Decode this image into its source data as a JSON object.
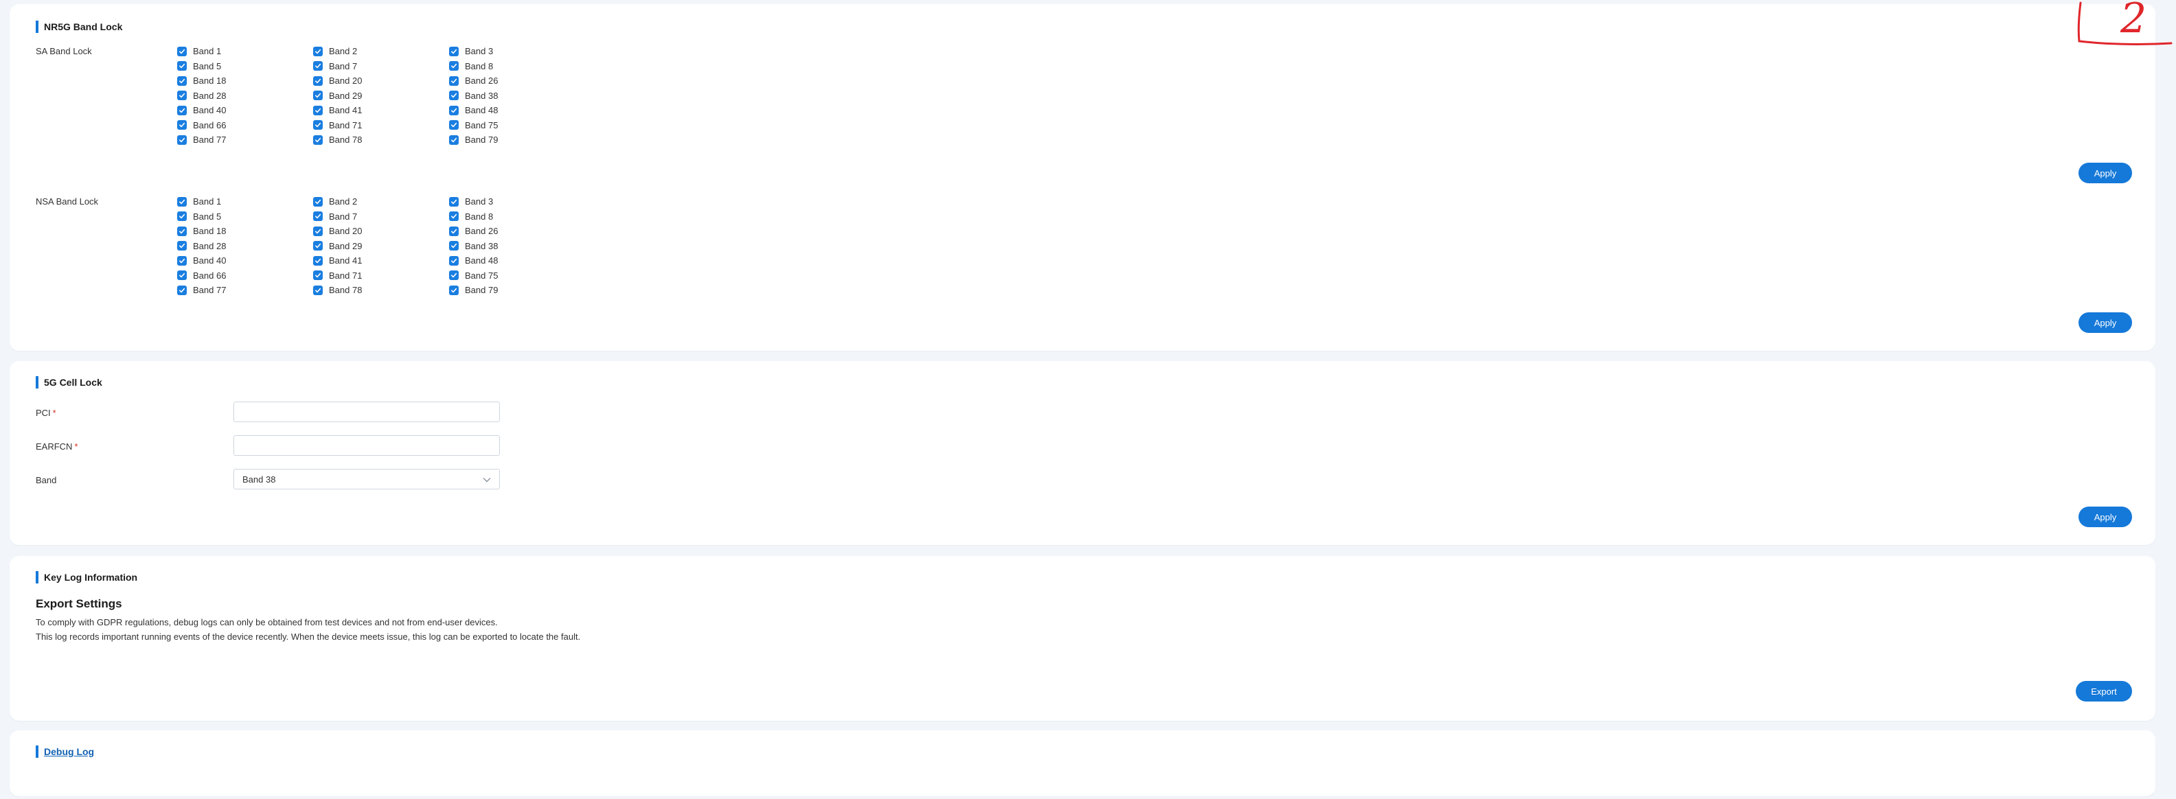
{
  "band_lock": {
    "title": "NR5G Band Lock",
    "sa": {
      "label": "SA Band Lock",
      "bands": [
        "Band 1",
        "Band 2",
        "Band 3",
        "Band 5",
        "Band 7",
        "Band 8",
        "Band 18",
        "Band 20",
        "Band 26",
        "Band 28",
        "Band 29",
        "Band 38",
        "Band 40",
        "Band 41",
        "Band 48",
        "Band 66",
        "Band 71",
        "Band 75",
        "Band 77",
        "Band 78",
        "Band 79"
      ],
      "apply_label": "Apply"
    },
    "nsa": {
      "label": "NSA Band Lock",
      "bands": [
        "Band 1",
        "Band 2",
        "Band 3",
        "Band 5",
        "Band 7",
        "Band 8",
        "Band 18",
        "Band 20",
        "Band 26",
        "Band 28",
        "Band 29",
        "Band 38",
        "Band 40",
        "Band 41",
        "Band 48",
        "Band 66",
        "Band 71",
        "Band 75",
        "Band 77",
        "Band 78",
        "Band 79"
      ],
      "apply_label": "Apply"
    },
    "checked": true
  },
  "cell_lock": {
    "title": "5G Cell Lock",
    "pci_label": "PCI",
    "pci_value": "",
    "earfcn_label": "EARFCN",
    "earfcn_value": "",
    "required_mark": "*",
    "band_label": "Band",
    "band_value": "Band 38",
    "apply_label": "Apply"
  },
  "key_log": {
    "title": "Key Log Information",
    "heading": "Export Settings",
    "line1": "To comply with GDPR regulations, debug logs can only be obtained from test devices and not from end-user devices.",
    "line2": "This log records important running events of the device recently. When the device meets issue, this log can be exported to locate the fault.",
    "export_label": "Export"
  },
  "debug_log": {
    "title": "Debug Log"
  },
  "annotation": {
    "text": "2"
  },
  "colors": {
    "accent": "#1579d9",
    "background": "#f2f6fb",
    "annotation": "#e0262b"
  }
}
